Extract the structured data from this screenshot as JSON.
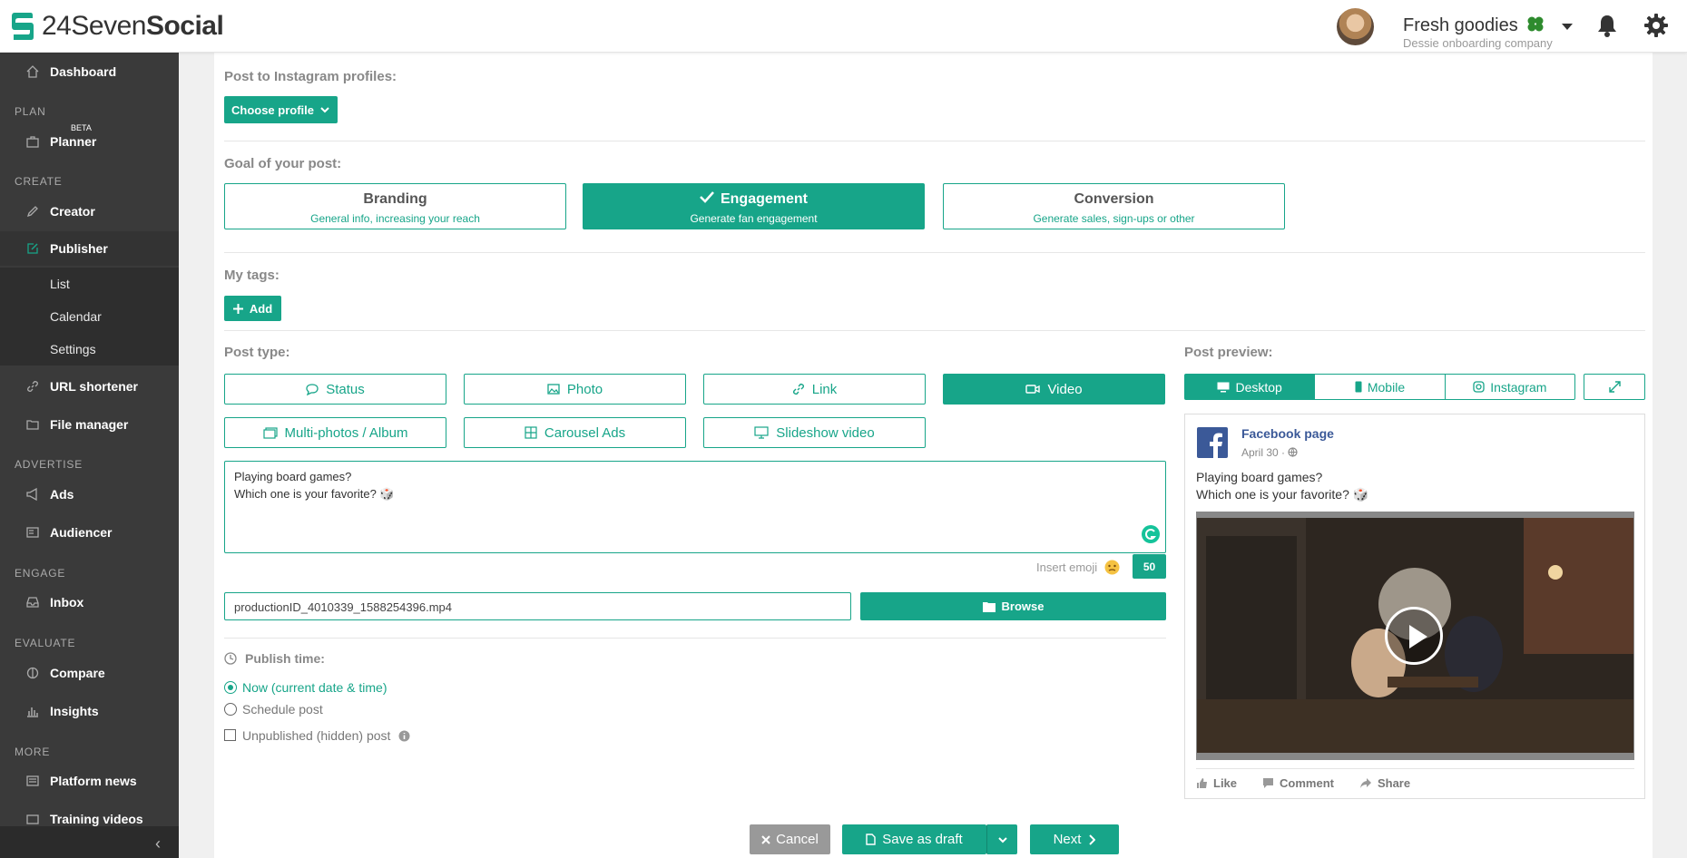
{
  "brand": {
    "name_light": "24Seven",
    "name_bold": "Social"
  },
  "account": {
    "name": "Fresh goodies",
    "company": "Dessie onboarding company"
  },
  "sidebar": {
    "dashboard": "Dashboard",
    "plan_header": "PLAN",
    "planner": "Planner",
    "planner_badge": "BETA",
    "create_header": "CREATE",
    "creator": "Creator",
    "publisher": "Publisher",
    "list": "List",
    "calendar": "Calendar",
    "settings": "Settings",
    "url_shortener": "URL shortener",
    "file_manager": "File manager",
    "advertise_header": "ADVERTISE",
    "ads": "Ads",
    "audiencer": "Audiencer",
    "engage_header": "ENGAGE",
    "inbox": "Inbox",
    "evaluate_header": "EVALUATE",
    "compare": "Compare",
    "insights": "Insights",
    "more_header": "MORE",
    "platform_news": "Platform news",
    "training_videos": "Training videos"
  },
  "instagram": {
    "label": "Post to Instagram profiles:",
    "choose_button": "Choose profile"
  },
  "goal": {
    "label": "Goal of your post:",
    "options": [
      {
        "title": "Branding",
        "subtitle": "General info, increasing your reach"
      },
      {
        "title": "Engagement",
        "subtitle": "Generate fan engagement"
      },
      {
        "title": "Conversion",
        "subtitle": "Generate sales, sign-ups or other"
      }
    ]
  },
  "tags": {
    "label": "My tags:",
    "add_button": "Add"
  },
  "post_type": {
    "label": "Post type:",
    "types": [
      "Status",
      "Photo",
      "Link",
      "Video",
      "Multi-photos / Album",
      "Carousel Ads",
      "Slideshow video"
    ],
    "selected": "Video"
  },
  "message": {
    "line1": "Playing board games?",
    "line2": "Which one is your favorite? 🎲"
  },
  "emoji": {
    "label": "Insert emoji",
    "char_count": "50"
  },
  "file": {
    "value": "productionID_4010339_1588254396.mp4",
    "browse_button": "Browse"
  },
  "publish": {
    "label": "Publish time:",
    "option_now": "Now (current date & time)",
    "option_schedule": "Schedule post",
    "option_unpublished": "Unpublished (hidden) post"
  },
  "preview": {
    "label": "Post preview:",
    "tabs": [
      "Desktop",
      "Mobile",
      "Instagram"
    ],
    "selected_tab": "Desktop",
    "page_name": "Facebook page",
    "date": "April 30 ·",
    "text_line1": "Playing board games?",
    "text_line2": "Which one is your favorite? 🎲",
    "actions": [
      "Like",
      "Comment",
      "Share"
    ]
  },
  "footer": {
    "cancel": "Cancel",
    "save_draft": "Save as draft",
    "next": "Next"
  },
  "colors": {
    "accent": "#17a589",
    "sidebar": "#3a3a3a",
    "facebook": "#3b5998"
  }
}
